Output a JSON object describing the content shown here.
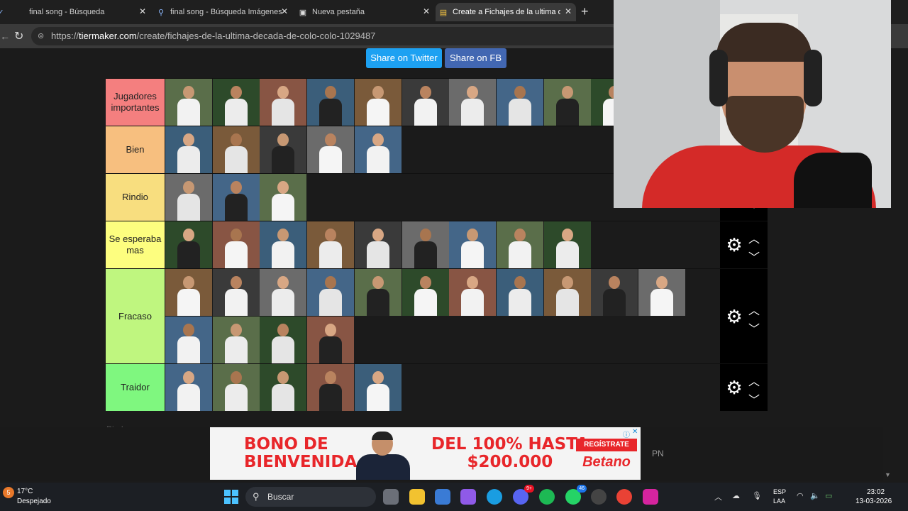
{
  "browser": {
    "tabs": [
      {
        "title": "final song - Búsqueda",
        "icon": "search-icon"
      },
      {
        "title": "final song - Búsqueda Imágenes",
        "icon": "search-icon"
      },
      {
        "title": "Nueva pestaña",
        "icon": "new-tab-page-icon"
      },
      {
        "title": "Create a Fichajes de la ultima deca",
        "icon": "tiermaker-icon",
        "active": true
      }
    ],
    "url_prefix": "https://",
    "url_domain": "tiermaker.com",
    "url_path": "/create/fichajes-de-la-ultima-decada-de-colo-colo-1029487"
  },
  "share": {
    "twitter_label": "Share on Twitter",
    "fb_label": "Share on FB",
    "twitter_color": "#1da1f2",
    "fb_color": "#4267b2"
  },
  "tiers": [
    {
      "label": "Jugadores importantes",
      "color": "#f47f7f",
      "count": 10
    },
    {
      "label": "Bien",
      "color": "#f7bf7f",
      "count": 5
    },
    {
      "label": "Rindio",
      "color": "#f8de7f",
      "count": 3
    },
    {
      "label": "Se esperaba mas",
      "color": "#fdfe7f",
      "count": 9
    },
    {
      "label": "Fracaso",
      "color": "#bff67f",
      "count": 15
    },
    {
      "label": "Traidor",
      "color": "#7ff77f",
      "count": 5
    }
  ],
  "pin_label": "Pin Images",
  "ad": {
    "left_text_1": "BONO DE",
    "left_text_2": "BIENVENIDA",
    "right_text_1": "DEL 100% HASTA",
    "right_text_2": "$200.000",
    "cta": "REGÍSTRATE",
    "brand": "Betano",
    "accent": "#e8262a"
  },
  "pn": "PN",
  "taskbar": {
    "weather_badge": "5",
    "temp": "17°C",
    "condition": "Despejado",
    "search_placeholder": "Buscar",
    "discord_badge": "9+",
    "whatsapp_badge": "46",
    "lang_1": "ESP",
    "lang_2": "LAA",
    "time": "23:02",
    "date": "13-03-2026"
  }
}
